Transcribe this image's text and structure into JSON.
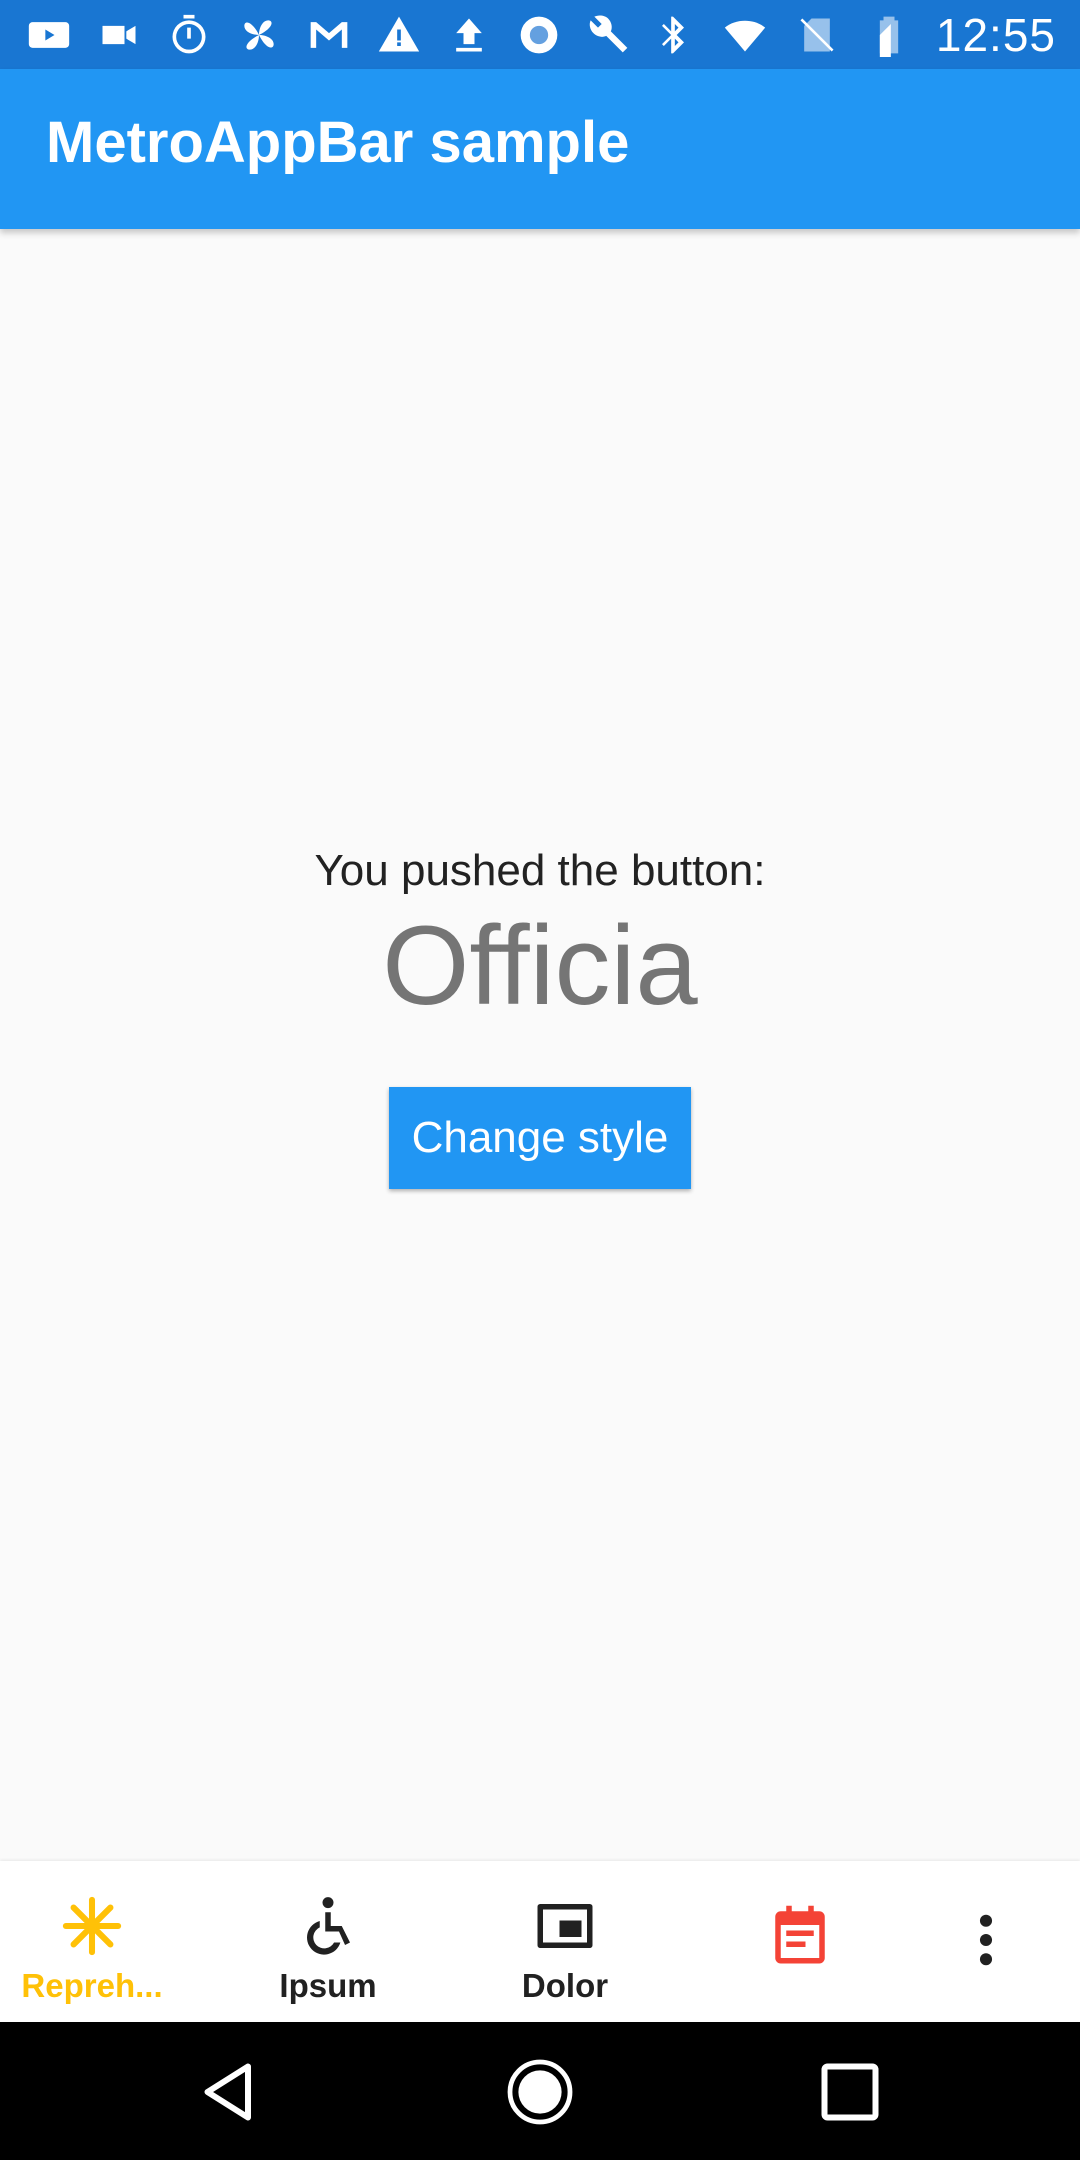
{
  "status_bar": {
    "time": "12:55",
    "left_icons": [
      "youtube-icon",
      "video-camera-icon",
      "stopwatch-icon",
      "pinwheel-icon",
      "gmail-icon",
      "warning-icon",
      "upload-icon",
      "record-icon",
      "wrench-icon"
    ],
    "right_icons": [
      "bluetooth-icon",
      "wifi-icon",
      "no-sim-icon",
      "battery-icon"
    ]
  },
  "appbar": {
    "title": "MetroAppBar sample"
  },
  "main": {
    "pushed_label": "You pushed the button:",
    "counter_value": "Officia",
    "change_style_label": "Change style"
  },
  "bottom_bar": {
    "items": [
      {
        "label": "Repreh...",
        "icon": "asterisk-icon",
        "color": "#ffc107"
      },
      {
        "label": "Ipsum",
        "icon": "accessible-icon",
        "color": "#212121"
      },
      {
        "label": "Dolor",
        "icon": "picture-in-picture-icon",
        "color": "#212121"
      },
      {
        "label": "",
        "icon": "calendar-event-icon",
        "color": "#f44336"
      }
    ],
    "overflow_icon": "more-vert-icon"
  },
  "colors": {
    "status_bar": "#1976d2",
    "primary": "#2196f3",
    "accent": "#ffc107"
  },
  "nav_bar": {
    "buttons": [
      "back-icon",
      "home-icon",
      "recents-icon"
    ]
  }
}
